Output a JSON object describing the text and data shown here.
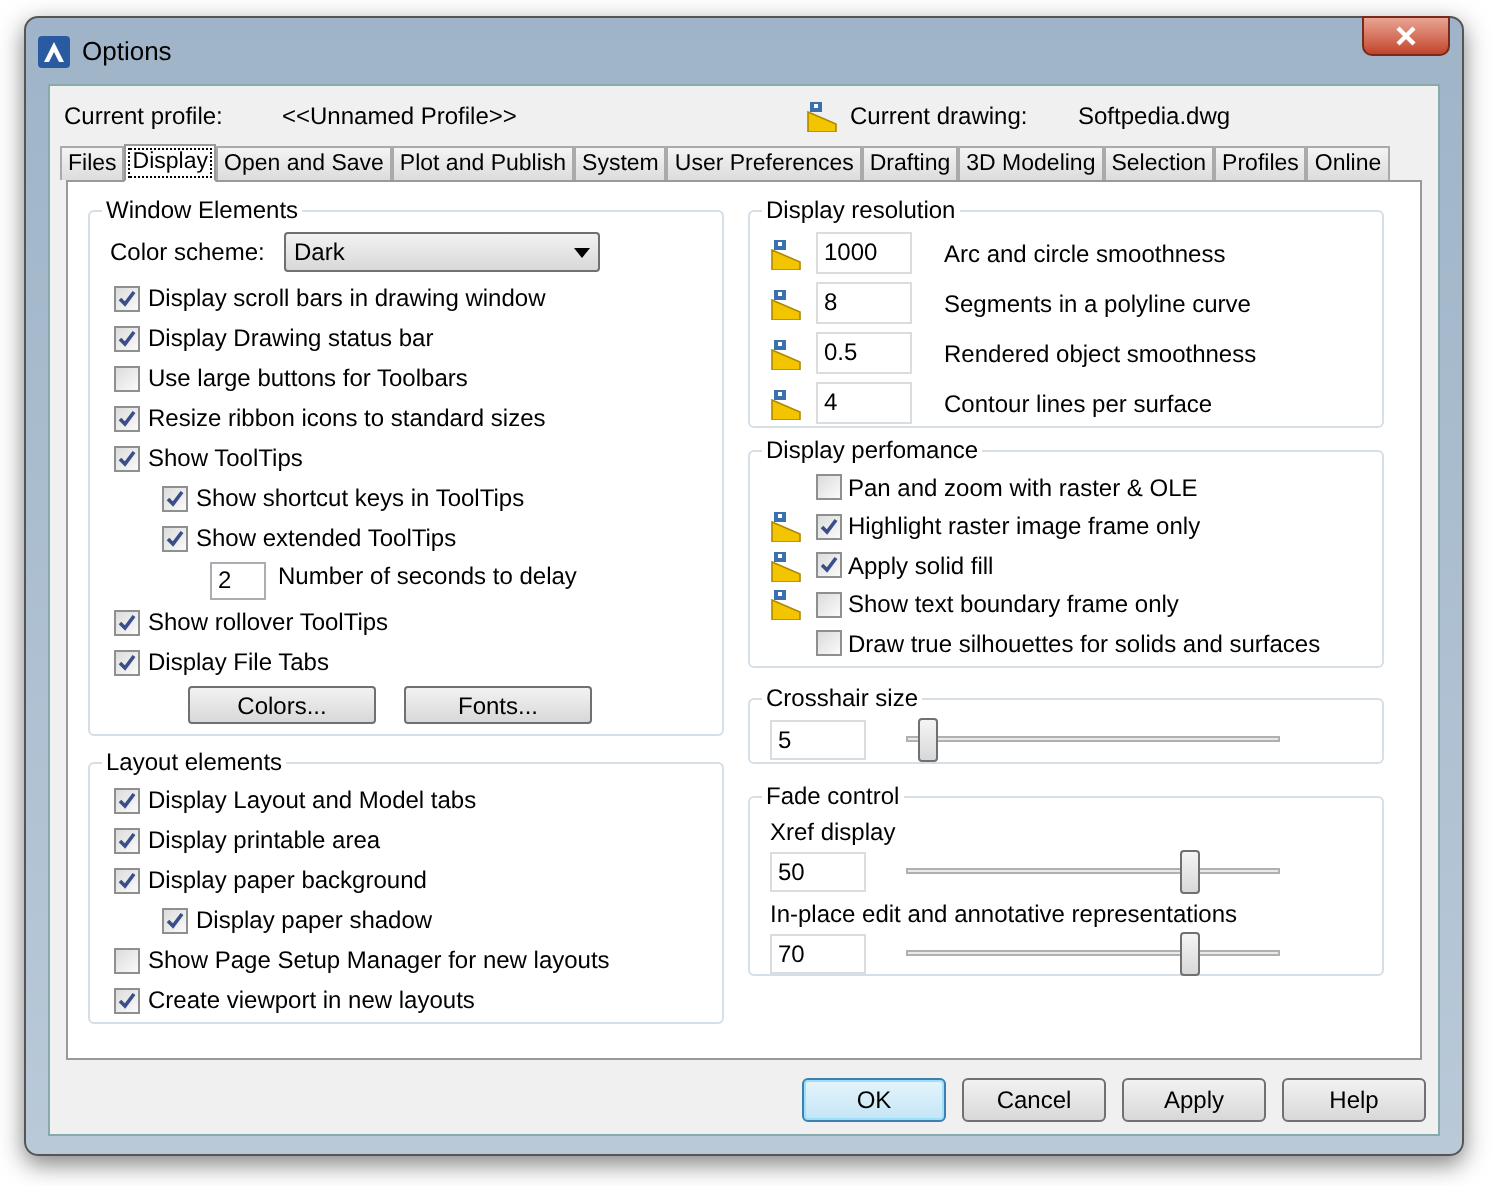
{
  "window": {
    "title": "Options"
  },
  "profile": {
    "label": "Current profile:",
    "value": "<<Unnamed Profile>>",
    "drawing_label": "Current drawing:",
    "drawing_value": "Softpedia.dwg"
  },
  "tabs": [
    {
      "label": "Files",
      "selected": false
    },
    {
      "label": "Display",
      "selected": true
    },
    {
      "label": "Open and Save",
      "selected": false
    },
    {
      "label": "Plot and Publish",
      "selected": false
    },
    {
      "label": "System",
      "selected": false
    },
    {
      "label": "User Preferences",
      "selected": false
    },
    {
      "label": "Drafting",
      "selected": false
    },
    {
      "label": "3D Modeling",
      "selected": false
    },
    {
      "label": "Selection",
      "selected": false
    },
    {
      "label": "Profiles",
      "selected": false
    },
    {
      "label": "Online",
      "selected": false
    }
  ],
  "window_elements": {
    "title": "Window Elements",
    "color_scheme": {
      "label": "Color scheme:",
      "value": "Dark"
    },
    "options": [
      {
        "kind": "checkbox",
        "label": "Display scroll bars in drawing window",
        "checked": true
      },
      {
        "kind": "checkbox",
        "label": "Display Drawing status bar",
        "checked": true
      },
      {
        "kind": "checkbox",
        "label": "Use large buttons for Toolbars",
        "checked": false
      },
      {
        "kind": "checkbox",
        "label": "Resize ribbon icons to standard sizes",
        "checked": true
      },
      {
        "kind": "checkbox",
        "label": "Show ToolTips",
        "checked": true,
        "children": [
          {
            "kind": "checkbox",
            "label": "Show shortcut keys in ToolTips",
            "checked": true
          },
          {
            "kind": "checkbox",
            "label": "Show extended ToolTips",
            "checked": true,
            "children": [
              {
                "kind": "number",
                "value": "2",
                "label": "Number of seconds to delay"
              }
            ]
          }
        ]
      },
      {
        "kind": "checkbox",
        "label": "Show rollover ToolTips",
        "checked": true
      },
      {
        "kind": "checkbox",
        "label": "Display File Tabs",
        "checked": true
      }
    ],
    "buttons": [
      "Colors...",
      "Fonts..."
    ]
  },
  "layout_elements": {
    "title": "Layout elements",
    "options": [
      {
        "kind": "checkbox",
        "label": "Display Layout and Model tabs",
        "checked": true
      },
      {
        "kind": "checkbox",
        "label": "Display printable area",
        "checked": true
      },
      {
        "kind": "checkbox",
        "label": "Display paper background",
        "checked": true,
        "children": [
          {
            "kind": "checkbox",
            "label": "Display paper shadow",
            "checked": true
          }
        ]
      },
      {
        "kind": "checkbox",
        "label": "Show Page Setup Manager for new layouts",
        "checked": false
      },
      {
        "kind": "checkbox",
        "label": "Create viewport in new layouts",
        "checked": true
      }
    ]
  },
  "display_resolution": {
    "title": "Display resolution",
    "rows": [
      {
        "value": "1000",
        "label": "Arc and circle smoothness"
      },
      {
        "value": "8",
        "label": "Segments in a polyline curve"
      },
      {
        "value": "0.5",
        "label": "Rendered object smoothness"
      },
      {
        "value": "4",
        "label": "Contour lines per surface"
      }
    ]
  },
  "display_performance": {
    "title": "Display perfomance",
    "rows": [
      {
        "label": "Pan and zoom with raster & OLE",
        "checked": false,
        "saved_in_drawing": false
      },
      {
        "label": "Highlight raster image frame only",
        "checked": true,
        "saved_in_drawing": true
      },
      {
        "label": "Apply solid fill",
        "checked": true,
        "saved_in_drawing": true
      },
      {
        "label": "Show text boundary frame only",
        "checked": false,
        "saved_in_drawing": true
      },
      {
        "label": "Draw true silhouettes for solids and surfaces",
        "checked": false,
        "saved_in_drawing": false
      }
    ]
  },
  "crosshair": {
    "title": "Crosshair size",
    "value": "5",
    "level": 0.06
  },
  "fade_control": {
    "title": "Fade control",
    "sliders": [
      {
        "label": "Xref display",
        "value": "50",
        "level": 0.76
      },
      {
        "label": "In-place edit and annotative representations",
        "value": "70",
        "level": 0.76
      }
    ]
  },
  "buttons": [
    {
      "label": "OK",
      "focused": true
    },
    {
      "label": "Cancel",
      "focused": false
    },
    {
      "label": "Apply",
      "focused": false
    },
    {
      "label": "Help",
      "focused": false
    }
  ]
}
